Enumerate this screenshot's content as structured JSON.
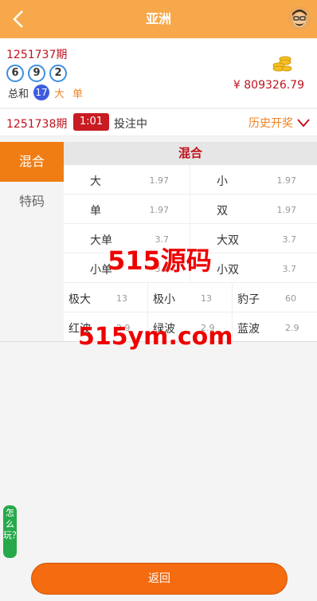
{
  "header": {
    "title": "亚洲"
  },
  "last_draw": {
    "period": "1251737期",
    "balls": [
      "6",
      "9",
      "2"
    ],
    "sum_label": "总和",
    "sum_value": "17",
    "size": "大",
    "parity": "单"
  },
  "balance": "¥ 809326.79",
  "current": {
    "period": "1251738期",
    "countdown": "1:01",
    "status": "投注中",
    "history_label": "历史开奖"
  },
  "sidebar": [
    {
      "label": "混合",
      "active": true
    },
    {
      "label": "特码",
      "active": false
    }
  ],
  "panel": {
    "title": "混合",
    "rows2": [
      {
        "label": "大",
        "odds": "1.97"
      },
      {
        "label": "小",
        "odds": "1.97"
      },
      {
        "label": "单",
        "odds": "1.97"
      },
      {
        "label": "双",
        "odds": "1.97"
      },
      {
        "label": "大单",
        "odds": "3.7"
      },
      {
        "label": "大双",
        "odds": "3.7"
      },
      {
        "label": "小单",
        "odds": "3.7"
      },
      {
        "label": "小双",
        "odds": "3.7"
      }
    ],
    "rows3": [
      {
        "label": "极大",
        "odds": "13"
      },
      {
        "label": "极小",
        "odds": "13"
      },
      {
        "label": "豹子",
        "odds": "60"
      },
      {
        "label": "红波",
        "odds": "2.9"
      },
      {
        "label": "绿波",
        "odds": "2.9"
      },
      {
        "label": "蓝波",
        "odds": "2.9"
      }
    ]
  },
  "watermark": {
    "line1": "515源码",
    "line2": "515ym.com"
  },
  "howto_label": "怎么玩？",
  "return_label": "返回",
  "colors": {
    "header": "#f7a84a",
    "accent": "#f07d14",
    "red": "#c0121e",
    "ball_border": "#3d8fe0"
  }
}
